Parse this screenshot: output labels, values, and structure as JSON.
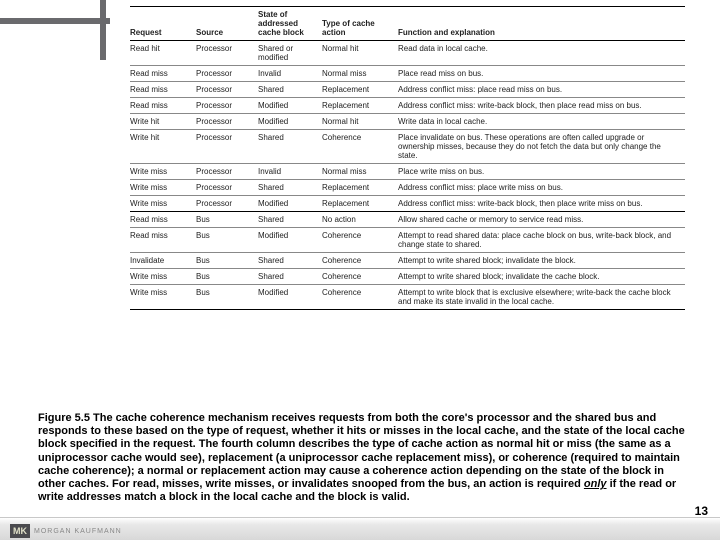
{
  "headers": {
    "request": "Request",
    "source": "Source",
    "state": "State of addressed cache block",
    "action": "Type of cache action",
    "function": "Function and explanation"
  },
  "rows": [
    {
      "heavy": false,
      "request": "Read hit",
      "source": "Processor",
      "state": "Shared or modified",
      "action": "Normal hit",
      "function": "Read data in local cache."
    },
    {
      "heavy": false,
      "request": "Read miss",
      "source": "Processor",
      "state": "Invalid",
      "action": "Normal miss",
      "function": "Place read miss on bus."
    },
    {
      "heavy": false,
      "request": "Read miss",
      "source": "Processor",
      "state": "Shared",
      "action": "Replacement",
      "function": "Address conflict miss: place read miss on bus."
    },
    {
      "heavy": false,
      "request": "Read miss",
      "source": "Processor",
      "state": "Modified",
      "action": "Replacement",
      "function": "Address conflict miss: write-back block, then place read miss on bus."
    },
    {
      "heavy": false,
      "request": "Write hit",
      "source": "Processor",
      "state": "Modified",
      "action": "Normal hit",
      "function": "Write data in local cache."
    },
    {
      "heavy": false,
      "request": "Write hit",
      "source": "Processor",
      "state": "Shared",
      "action": "Coherence",
      "function": "Place invalidate on bus. These operations are often called upgrade or ownership misses, because they do not fetch the data but only change the state."
    },
    {
      "heavy": false,
      "request": "Write miss",
      "source": "Processor",
      "state": "Invalid",
      "action": "Normal miss",
      "function": "Place write miss on bus."
    },
    {
      "heavy": false,
      "request": "Write miss",
      "source": "Processor",
      "state": "Shared",
      "action": "Replacement",
      "function": "Address conflict miss: place write miss on bus."
    },
    {
      "heavy": true,
      "request": "Write miss",
      "source": "Processor",
      "state": "Modified",
      "action": "Replacement",
      "function": "Address conflict miss: write-back block, then place write miss on bus."
    },
    {
      "heavy": false,
      "request": "Read miss",
      "source": "Bus",
      "state": "Shared",
      "action": "No action",
      "function": "Allow shared cache or memory to service read miss."
    },
    {
      "heavy": false,
      "request": "Read miss",
      "source": "Bus",
      "state": "Modified",
      "action": "Coherence",
      "function": "Attempt to read shared data: place cache block on bus, write-back block, and change state to shared."
    },
    {
      "heavy": false,
      "request": "Invalidate",
      "source": "Bus",
      "state": "Shared",
      "action": "Coherence",
      "function": "Attempt to write shared block; invalidate the block."
    },
    {
      "heavy": false,
      "request": "Write miss",
      "source": "Bus",
      "state": "Shared",
      "action": "Coherence",
      "function": "Attempt to write shared block; invalidate the cache block."
    },
    {
      "heavy": true,
      "request": "Write miss",
      "source": "Bus",
      "state": "Modified",
      "action": "Coherence",
      "function": "Attempt to write block that is exclusive elsewhere; write-back the cache block and make its state invalid in the local cache."
    }
  ],
  "caption": {
    "lead": "Figure 5.5 The cache coherence mechanism receives requests from both the core's processor and the shared bus and responds to these based on the type of request, whether it hits or misses in the local cache, and the state of the local cache block specified in the request.",
    "rest1": " The fourth column describes the type of cache action as normal hit or miss (the same as a uniprocessor cache would see), replacement (a uniprocessor cache replacement miss), or coherence (required to maintain cache coherence); a normal or replacement action may cause a coherence action depending on the state of the block in other caches. For read, misses, write misses, or invalidates snooped from the bus, an action is required ",
    "only": "only",
    "rest2": " if the read or write addresses match a block in the local cache and the block is valid."
  },
  "footer": {
    "logo_mk": "MK",
    "logo_text": "MORGAN KAUFMANN",
    "page": "13"
  }
}
